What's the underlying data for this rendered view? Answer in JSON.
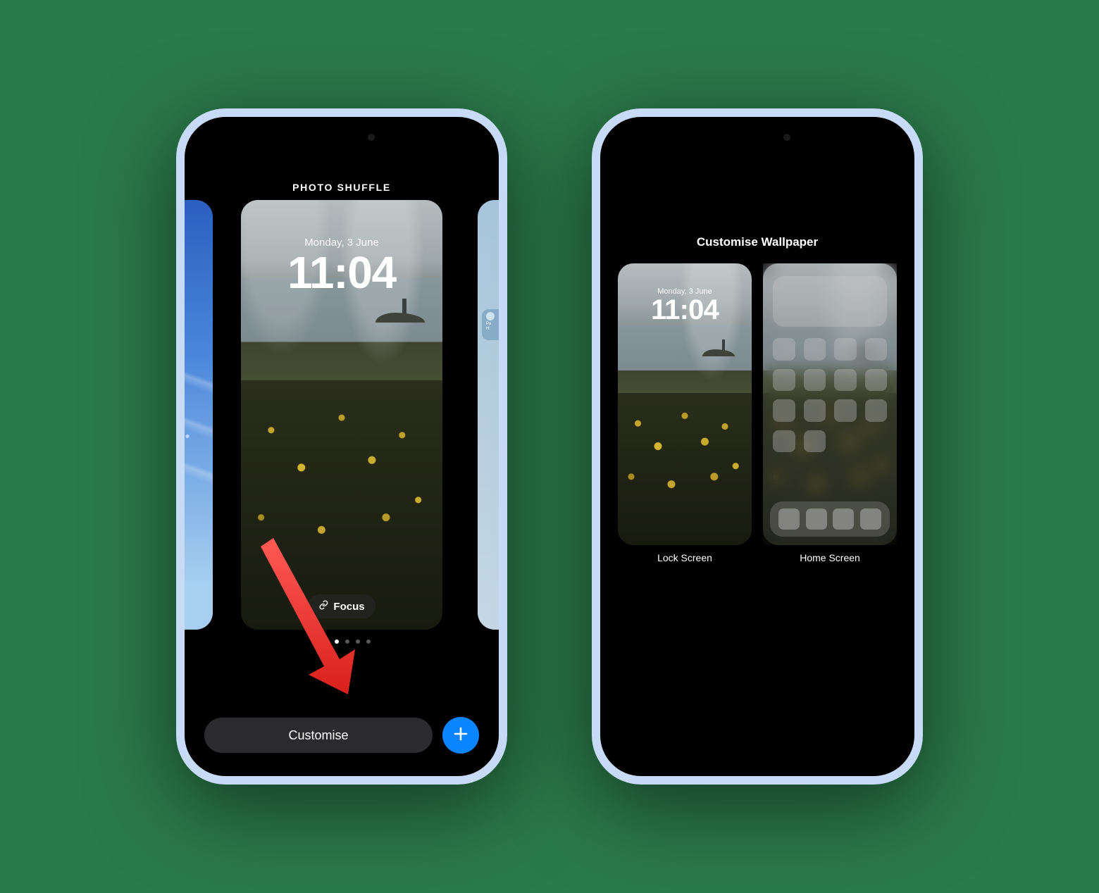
{
  "left": {
    "header": "PHOTO SHUFFLE",
    "lockscreen": {
      "date": "Monday, 3 June",
      "time": "11:04"
    },
    "focus_pill": "Focus",
    "side_right_widget": {
      "line1": "Pa",
      "line2": "H:"
    },
    "page_dots": {
      "count": 6,
      "active_index": 2
    },
    "customise_button": "Customise",
    "add_button_aria": "Add"
  },
  "right": {
    "header": "Customise Wallpaper",
    "lockscreen": {
      "date": "Monday, 3 June",
      "time": "11:04"
    },
    "lock_label": "Lock Screen",
    "home_label": "Home Screen",
    "home_icon_rows": [
      4,
      4,
      4,
      2
    ],
    "dock_icons": 4
  }
}
